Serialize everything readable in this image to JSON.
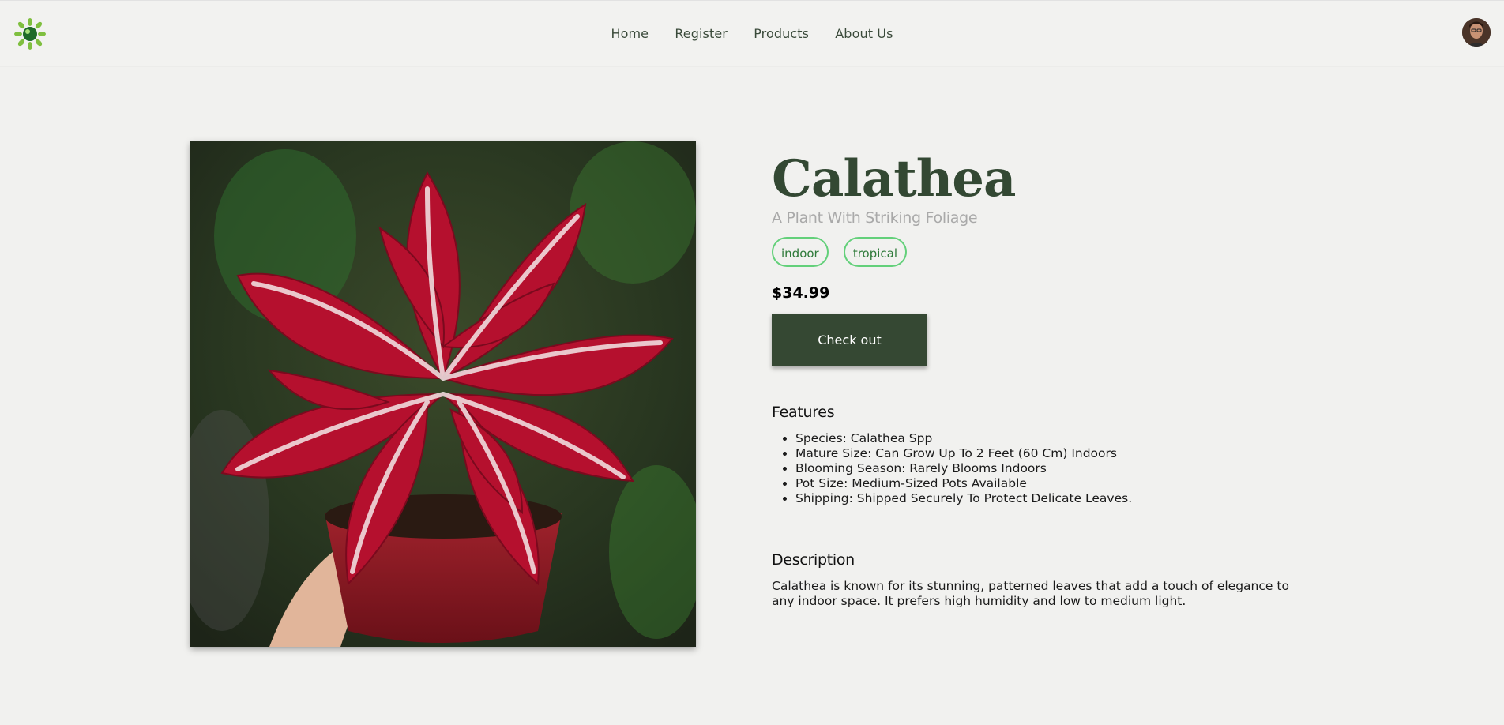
{
  "nav": {
    "links": [
      "Home",
      "Register",
      "Products",
      "About Us"
    ]
  },
  "product": {
    "name": "Calathea",
    "tagline": "A Plant With Striking Foliage",
    "tags": [
      "indoor",
      "tropical"
    ],
    "price": "$34.99",
    "checkout_label": "Check out",
    "features_heading": "Features",
    "features": [
      "Species: Calathea Spp",
      "Mature Size: Can Grow Up To 2 Feet (60 Cm) Indoors",
      "Blooming Season: Rarely Blooms Indoors",
      "Pot Size: Medium-Sized Pots Available",
      "Shipping: Shipped Securely To Protect Delicate Leaves."
    ],
    "description_heading": "Description",
    "description": "Calathea is known for its stunning, patterned leaves that add a touch of elegance to any indoor space. It prefers high humidity and low to medium light."
  },
  "colors": {
    "accent": "#354833",
    "tag_border": "#63d07a",
    "background": "#f1f1ef"
  },
  "icons": {
    "logo": "plant-logo-icon",
    "avatar": "user-avatar"
  }
}
